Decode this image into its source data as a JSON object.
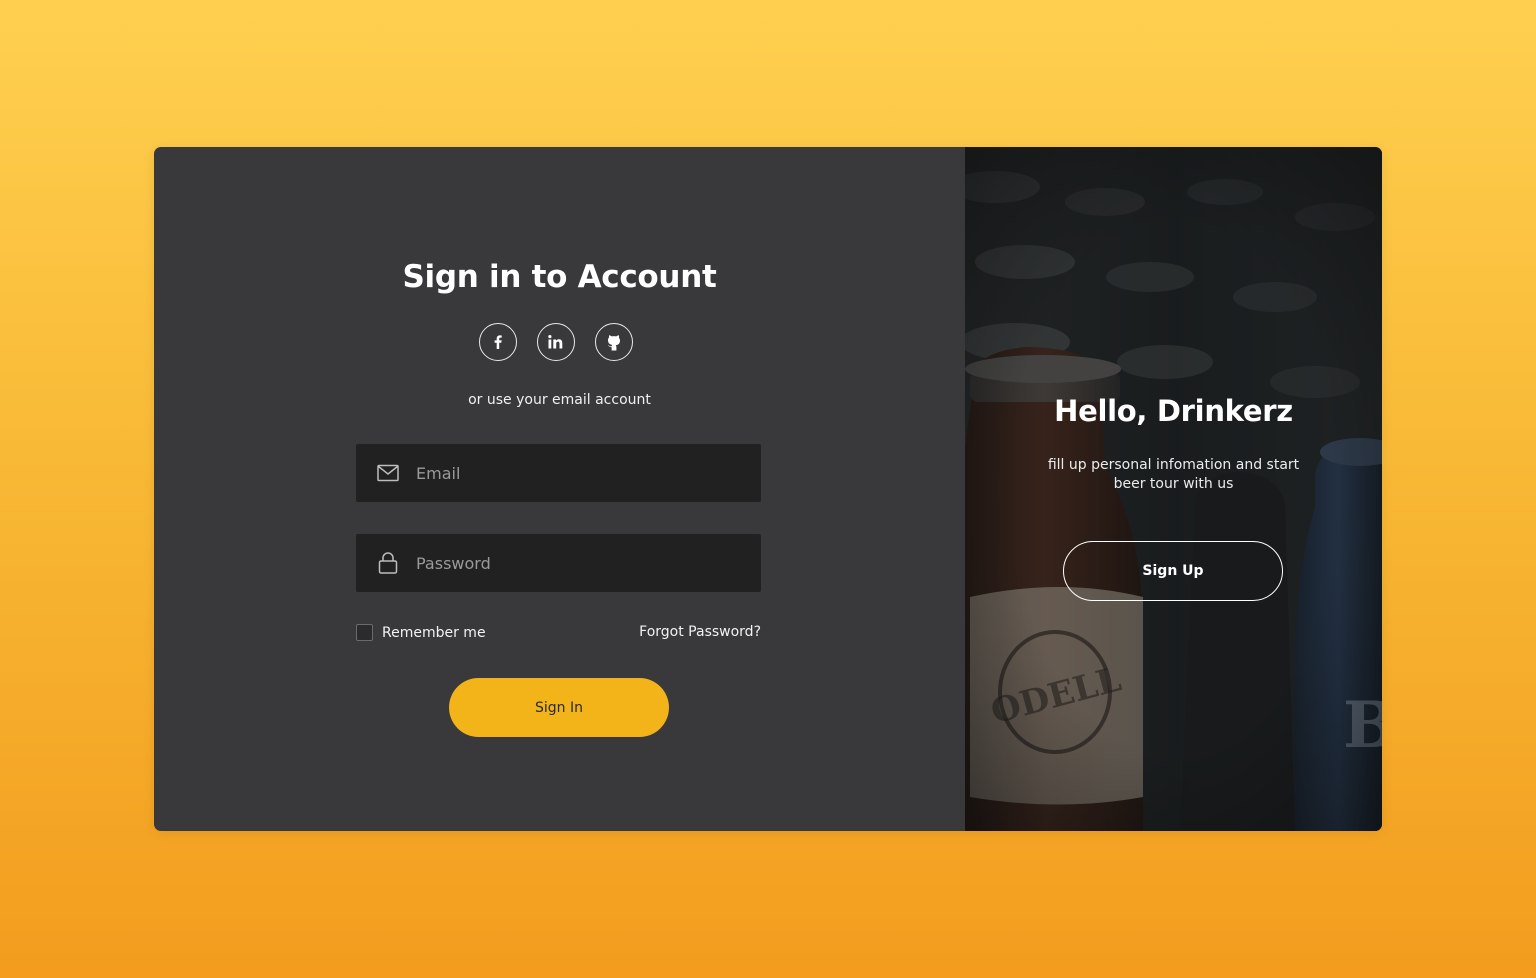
{
  "signin": {
    "title": "Sign in to Account",
    "subtitle": "or use your email account",
    "socials": [
      {
        "icon": "facebook-icon"
      },
      {
        "icon": "linkedin-icon"
      },
      {
        "icon": "github-icon"
      }
    ],
    "email_placeholder": "Email",
    "password_placeholder": "Password",
    "remember_label": "Remember me",
    "forgot_label": "Forgot Password?",
    "button_label": "Sign In"
  },
  "signup": {
    "title": "Hello, Drinkerz",
    "description": "fill up personal infomation and start beer tour with us",
    "button_label": "Sign Up"
  },
  "colors": {
    "background_top": "#ffd050",
    "background_bottom": "#f39c1e",
    "panel": "#39393b",
    "field": "#212121",
    "accent": "#f2b418"
  }
}
